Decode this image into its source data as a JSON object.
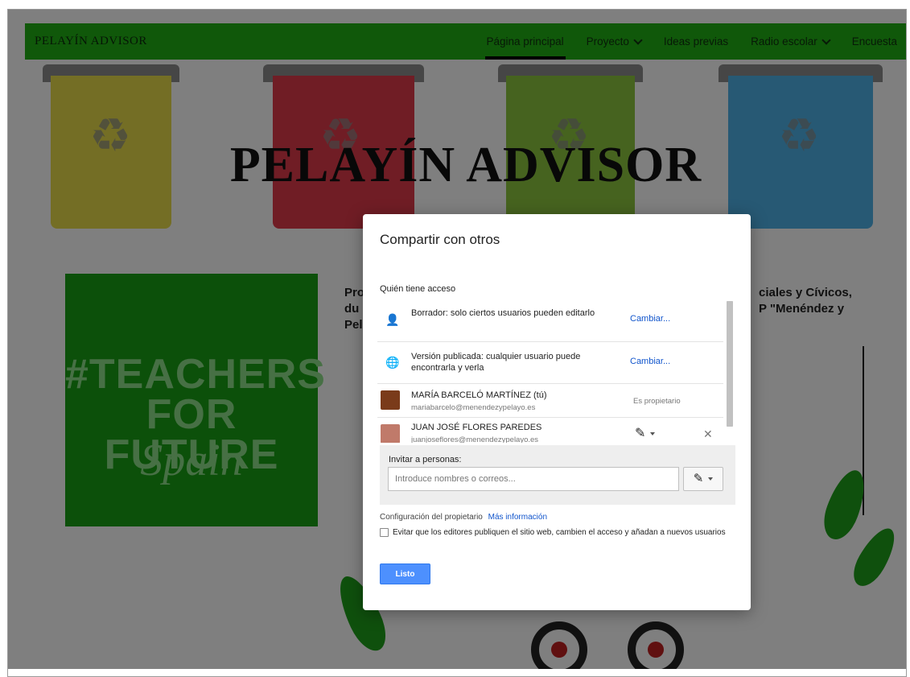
{
  "site": {
    "brand": "PELAYÍN ADVISOR",
    "nav": [
      {
        "label": "Página principal",
        "active": true,
        "dropdown": false
      },
      {
        "label": "Proyecto",
        "active": false,
        "dropdown": true
      },
      {
        "label": "Ideas previas",
        "active": false,
        "dropdown": false
      },
      {
        "label": "Radio escolar",
        "active": false,
        "dropdown": true
      },
      {
        "label": "Encuesta",
        "active": false,
        "dropdown": false
      }
    ],
    "hero_title": "PELAYÍN ADVISOR",
    "teachers_line1": "#TEACHERS",
    "teachers_line2": "FOR FUTURE",
    "teachers_line3": "Spain",
    "body_left": [
      "Pro",
      "du",
      "Pel"
    ],
    "body_right": [
      "ciales y Cívicos,",
      "P \"Menéndez y"
    ],
    "colors": {
      "nav_green": "#20b014",
      "square_green": "#19a114"
    }
  },
  "dialog": {
    "title": "Compartir con otros",
    "who_label": "Quién tiene acceso",
    "access_rows": [
      {
        "icon": "person-icon",
        "text": "Borrador: solo ciertos usuarios pueden editarlo",
        "action": "Cambiar..."
      },
      {
        "icon": "globe-icon",
        "text": "Versión publicada: cualquier usuario puede encontrarla y verla",
        "action": "Cambiar..."
      }
    ],
    "people": [
      {
        "name": "MARÍA BARCELÓ MARTÍNEZ (tú)",
        "email": "mariabarcelo@menendezypelayo.es",
        "role": "Es propietario"
      },
      {
        "name": "JUAN JOSÉ FLORES PAREDES",
        "email": "juanjoseflores@menendezypelayo.es"
      }
    ],
    "invite": {
      "label": "Invitar a personas:",
      "placeholder": "Introduce nombres o correos..."
    },
    "owner_config": "Configuración del propietario",
    "more_info": "Más información",
    "checkbox_label": "Evitar que los editores publiquen el sitio web, cambien el acceso y añadan a nuevos usuarios",
    "done_label": "Listo",
    "colors": {
      "link": "#1155cc",
      "button": "#4d90fe"
    }
  }
}
